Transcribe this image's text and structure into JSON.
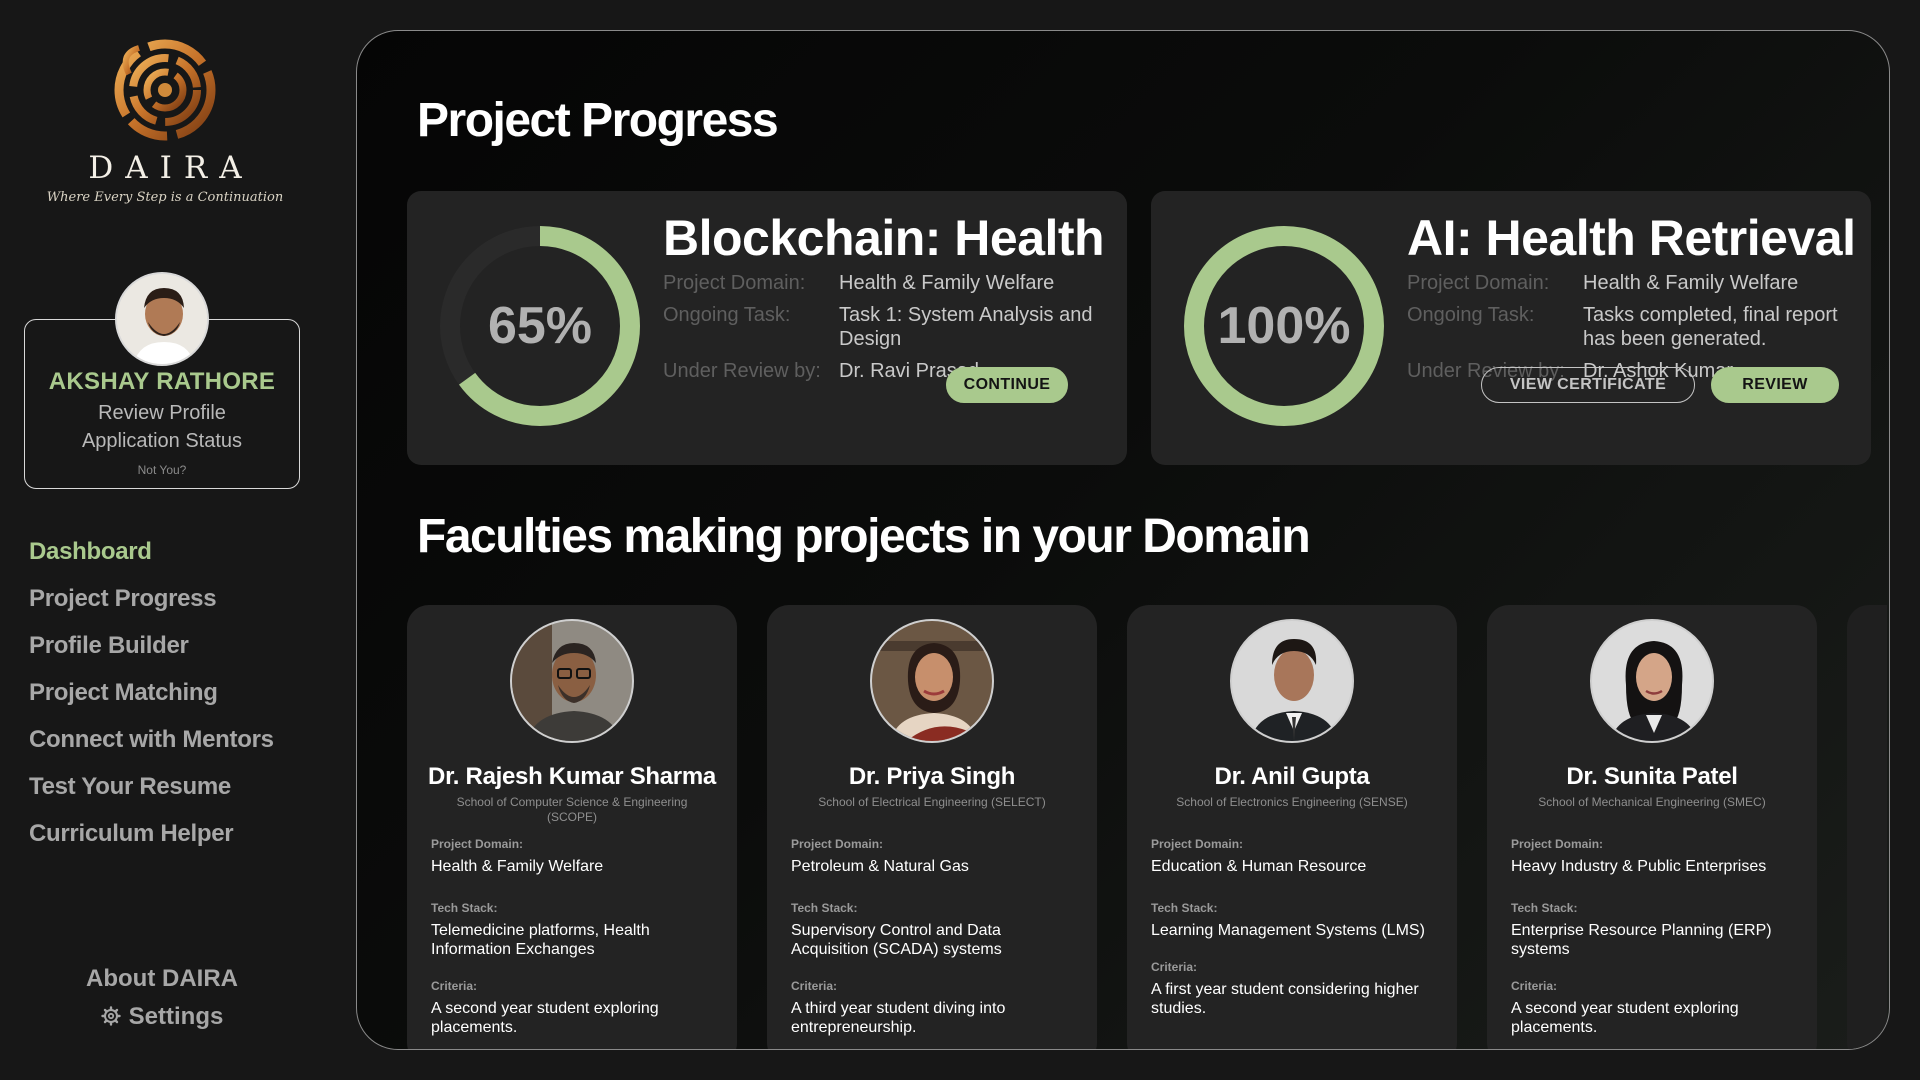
{
  "brand": {
    "name": "DAIRA",
    "tagline": "Where Every Step is a Continuation"
  },
  "user": {
    "name": "AKSHAY RATHORE",
    "line1": "Review Profile",
    "line2": "Application Status",
    "not_you": "Not You?"
  },
  "nav": {
    "items": [
      {
        "label": "Dashboard",
        "active": true
      },
      {
        "label": "Project Progress",
        "active": false
      },
      {
        "label": "Profile Builder",
        "active": false
      },
      {
        "label": "Project Matching",
        "active": false
      },
      {
        "label": "Connect with Mentors",
        "active": false
      },
      {
        "label": "Test Your Resume",
        "active": false
      },
      {
        "label": "Curriculum Helper",
        "active": false
      }
    ],
    "about": "About DAIRA",
    "settings": "Settings"
  },
  "colors": {
    "accent": "#a9c98d",
    "ring_track": "#2a2a2a",
    "card": "#232323"
  },
  "progress": {
    "heading": "Project Progress",
    "labels": {
      "domain": "Project Domain:",
      "task": "Ongoing Task:",
      "review": "Under Review by:"
    },
    "projects": [
      {
        "title": "Blockchain: Health",
        "percent_label": "65%",
        "progress": 0.65,
        "domain": "Health & Family Welfare",
        "task": "Task 1: System Analysis and Design",
        "reviewer": "Dr. Ravi Prasad",
        "primary_button": "CONTINUE"
      },
      {
        "title": "AI: Health Retrieval",
        "percent_label": "100%",
        "progress": 1.0,
        "domain": "Health & Family Welfare",
        "task": "Tasks completed, final report has been generated.",
        "reviewer": "Dr. Ashok Kumar",
        "secondary_button": "VIEW CERTIFICATE",
        "primary_button": "REVIEW"
      }
    ]
  },
  "faculties": {
    "heading": "Faculties making projects in your Domain",
    "labels": {
      "domain": "Project Domain:",
      "tech": "Tech Stack:",
      "criteria": "Criteria:"
    },
    "cards": [
      {
        "name": "Dr. Rajesh Kumar Sharma",
        "school": "School of Computer Science & Engineering (SCOPE)",
        "domain": "Health & Family Welfare",
        "tech": "Telemedicine platforms, Health Information Exchanges",
        "criteria": "A second year student exploring placements."
      },
      {
        "name": "Dr. Priya Singh",
        "school": "School of Electrical Engineering (SELECT)",
        "domain": "Petroleum & Natural Gas",
        "tech": "Supervisory Control and Data Acquisition (SCADA) systems",
        "criteria": "A third year student diving into entrepreneurship."
      },
      {
        "name": "Dr. Anil Gupta",
        "school": "School of Electronics Engineering (SENSE)",
        "domain": "Education & Human Resource",
        "tech": "Learning Management Systems (LMS)",
        "criteria": "A first year student considering higher studies."
      },
      {
        "name": "Dr. Sunita Patel",
        "school": "School of Mechanical Engineering (SMEC)",
        "domain": "Heavy Industry & Public Enterprises",
        "tech": "Enterprise Resource Planning (ERP) systems",
        "criteria": "A second year student exploring placements."
      }
    ]
  }
}
